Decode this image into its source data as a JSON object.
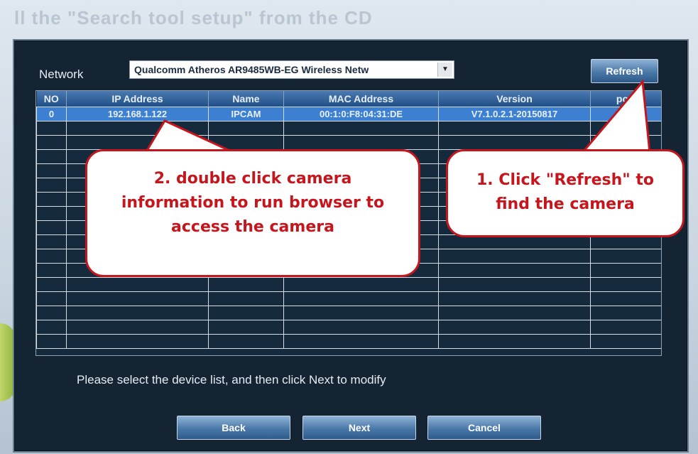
{
  "window": {
    "title_fragment": "ll the \"Search tool  setup\" from the CD"
  },
  "network": {
    "label": "Network",
    "adapter_value": "Qualcomm Atheros AR9485WB-EG Wireless Netw",
    "dropdown_arrow": "▼"
  },
  "toolbar": {
    "refresh_label": "Refresh"
  },
  "table": {
    "columns": [
      "NO",
      "IP Address",
      "Name",
      "MAC Address",
      "Version",
      "port"
    ],
    "rows": [
      [
        "0",
        "192.168.1.122",
        "IPCAM",
        "00:1:0:F8:04:31:DE",
        "V7.1.0.2.1-20150817",
        ""
      ]
    ],
    "empty_row_count": 16
  },
  "hint": "Please select the device list, and then click Next to modify",
  "buttons": {
    "back": "Back",
    "next": "Next",
    "cancel": "Cancel"
  },
  "callouts": {
    "step2": [
      "2. double click camera",
      "information to run browser to",
      "access the camera"
    ],
    "step1": [
      "1. Click \"Refresh\" to",
      "find the camera"
    ]
  },
  "colors": {
    "dialog_bg": "#142433",
    "accent_blue": "#3d7fd0",
    "callout_red": "#c4161c"
  }
}
